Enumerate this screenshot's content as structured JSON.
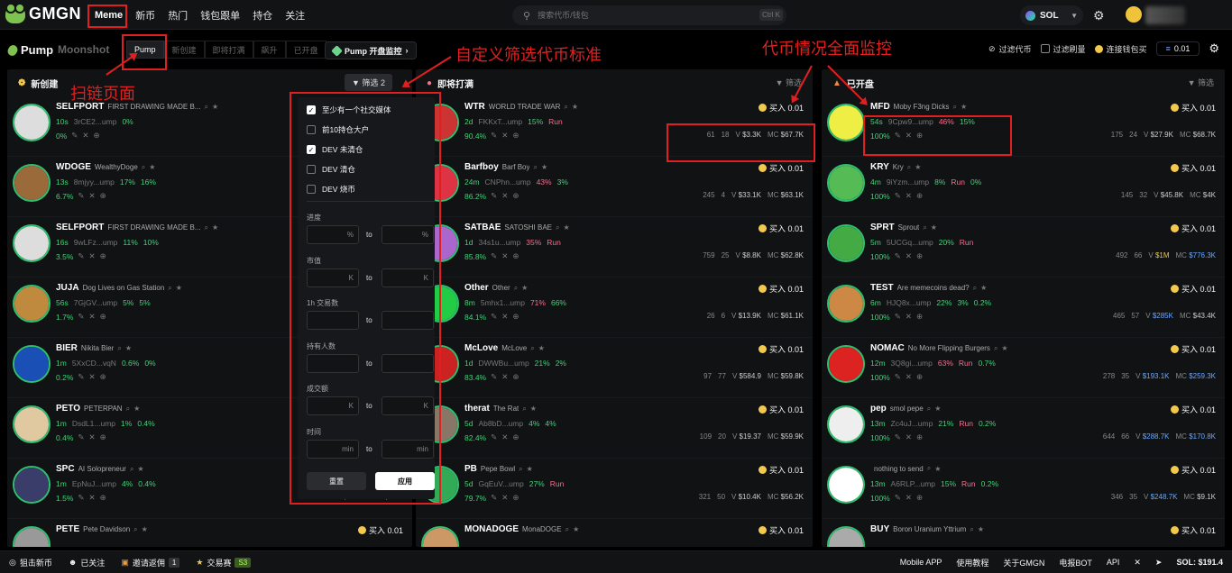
{
  "header": {
    "logo": "GMGN",
    "nav": [
      "Meme",
      "新币",
      "热门",
      "钱包跟单",
      "持仓",
      "关注"
    ],
    "search_placeholder": "搜索代币/钱包",
    "search_kbd": "Ctrl K",
    "chain": "SOL"
  },
  "subbar": {
    "pump": "Pump",
    "moonshot": "Moonshot",
    "tabs": [
      "Pump",
      "新创建",
      "即将打满",
      "飙升",
      "已开盘"
    ],
    "monitor": "Pump 开盘监控",
    "filter_coins": "过滤代币",
    "filter_dup": "过滤刷量",
    "link_wallet": "连接钱包买",
    "buy_amount": "0.01"
  },
  "columns": {
    "new": {
      "title": "新创建",
      "filter": "筛选",
      "filter_count": "2"
    },
    "soon": {
      "title": "即将打满",
      "filter": "筛选"
    },
    "opened": {
      "title": "已开盘",
      "filter": "筛选"
    }
  },
  "buy_label": "买入 0.01",
  "new_rows": [
    {
      "sym": "SELFPORT",
      "full": "FIRST DRAWING MADE B...",
      "age": "10s",
      "addr": "3rCE2...ump",
      "h1": "",
      "h2": "0%",
      "pct": "0%",
      "av": "#ddd"
    },
    {
      "sym": "WDOGE",
      "full": "WealthyDoge",
      "age": "13s",
      "addr": "8mjyy...ump",
      "h1": "17%",
      "h2": "16%",
      "pct": "6.7%",
      "av": "#9a6a3a"
    },
    {
      "sym": "SELFPORT",
      "full": "FIRST DRAWING MADE B...",
      "age": "16s",
      "addr": "9wLFz...ump",
      "h1": "11%",
      "h2": "10%",
      "pct": "3.5%",
      "av": "#ddd"
    },
    {
      "sym": "JUJA",
      "full": "Dog Lives on Gas Station",
      "age": "56s",
      "addr": "7GjGV...ump",
      "h1": "5%",
      "h2": "5%",
      "pct": "1.7%",
      "av": "#c08a3e"
    },
    {
      "sym": "BIER",
      "full": "Nikita Bier",
      "age": "1m",
      "addr": "5XxCD...vqN",
      "h1": "0.6%",
      "h2": "0%",
      "pct": "0.2%",
      "av": "#1a4fb5"
    },
    {
      "sym": "PETO",
      "full": "PETERPAN",
      "age": "1m",
      "addr": "DsdL1...ump",
      "h1": "1%",
      "h2": "0.4%",
      "pct": "0.4%",
      "av": "#e0c8a0"
    },
    {
      "sym": "SPC",
      "full": "AI Solopreneur",
      "age": "1m",
      "addr": "EpNuJ...ump",
      "h1": "4%",
      "h2": "0.4%",
      "pct": "1.5%",
      "av": "#3a3d6a",
      "st1": "3",
      "st2": "$264.7",
      "mc": "$5.8K"
    },
    {
      "sym": "PETE",
      "full": "Pete Davidson",
      "age": "",
      "addr": "",
      "h1": "",
      "h2": "",
      "pct": "",
      "av": "#999"
    }
  ],
  "soon_rows": [
    {
      "sym": "WTR",
      "full": "WORLD TRADE WAR",
      "age": "2d",
      "addr": "FKKxT...ump",
      "h1": "15%",
      "h1c": "g",
      "h2": "Run",
      "h2c": "r",
      "pct": "90.4%",
      "s1": "61",
      "s2": "18",
      "v": "$3.3K",
      "mc": "$67.7K",
      "av": "#c33"
    },
    {
      "sym": "Barfboy",
      "full": "Barf Boy",
      "age": "24m",
      "addr": "CNPhn...ump",
      "h1": "43%",
      "h1c": "r",
      "h2": "3%",
      "h2c": "g",
      "pct": "86.2%",
      "s1": "245",
      "s2": "4",
      "v": "$33.1K",
      "mc": "$63.1K",
      "av": "#d34"
    },
    {
      "sym": "SATBAE",
      "full": "SATOSHI BAE",
      "age": "1d",
      "addr": "34s1u...ump",
      "h1": "35%",
      "h1c": "r",
      "h2": "Run",
      "h2c": "r",
      "pct": "85.8%",
      "s1": "759",
      "s2": "25",
      "v": "$8.8K",
      "mc": "$62.8K",
      "av": "#a6c"
    },
    {
      "sym": "Other",
      "full": "Other",
      "age": "8m",
      "addr": "5mhx1...ump",
      "h1": "71%",
      "h1c": "r",
      "h2": "66%",
      "h2c": "g",
      "pct": "84.1%",
      "s1": "26",
      "s2": "6",
      "v": "$13.9K",
      "mc": "$61.1K",
      "av": "#2c4"
    },
    {
      "sym": "McLove",
      "full": "McLove",
      "age": "1d",
      "addr": "DWWBu...ump",
      "h1": "21%",
      "h1c": "g",
      "h2": "2%",
      "h2c": "g",
      "pct": "83.4%",
      "s1": "97",
      "s2": "77",
      "v": "$584.9",
      "mc": "$59.8K",
      "av": "#c22"
    },
    {
      "sym": "therat",
      "full": "The Rat",
      "age": "5d",
      "addr": "Ab8bD...ump",
      "h1": "4%",
      "h1c": "g",
      "h2": "4%",
      "h2c": "g",
      "pct": "82.4%",
      "s1": "109",
      "s2": "20",
      "v": "$19.37",
      "mc": "$59.9K",
      "av": "#876"
    },
    {
      "sym": "PB",
      "full": "Pepe Bowl",
      "age": "5d",
      "addr": "GqEuV...ump",
      "h1": "27%",
      "h1c": "g",
      "h2": "Run",
      "h2c": "r",
      "pct": "79.7%",
      "s1": "321",
      "s2": "50",
      "v": "$10.4K",
      "mc": "$56.2K",
      "av": "#3a5"
    },
    {
      "sym": "MONADOGE",
      "full": "MonaDOGE",
      "age": "",
      "addr": "",
      "h1": "",
      "h1c": "g",
      "h2": "",
      "h2c": "g",
      "pct": "",
      "s1": "",
      "s2": "",
      "v": "",
      "mc": "",
      "av": "#c96"
    }
  ],
  "opened_rows": [
    {
      "sym": "MFD",
      "full": "Moby F3ng Dicks",
      "age": "54s",
      "addr": "9Cpw9...ump",
      "h1": "46%",
      "h1c": "r",
      "h2": "15%",
      "h2c": "g",
      "h3": "",
      "pct": "100%",
      "s1": "175",
      "s2": "24",
      "v": "$27.9K",
      "mc": "$68.7K",
      "vc": "",
      "mcc": "",
      "av": "#ee4"
    },
    {
      "sym": "KRY",
      "full": "Kry",
      "age": "4m",
      "addr": "9iYzm...ump",
      "h1": "8%",
      "h1c": "g",
      "h2": "Run",
      "h2c": "r",
      "h3": "0%",
      "pct": "100%",
      "s1": "145",
      "s2": "32",
      "v": "$45.8K",
      "mc": "$4K",
      "vc": "",
      "mcc": "",
      "av": "#5b5"
    },
    {
      "sym": "SPRT",
      "full": "Sprout",
      "age": "5m",
      "addr": "5UCGq...ump",
      "h1": "20%",
      "h1c": "g",
      "h2": "Run",
      "h2c": "r",
      "h3": "",
      "pct": "100%",
      "s1": "492",
      "s2": "66",
      "v": "$1M",
      "mc": "$776.3K",
      "vc": "yel",
      "mcc": "blue",
      "av": "#4a4"
    },
    {
      "sym": "TEST",
      "full": "Are memecoins dead?",
      "age": "6m",
      "addr": "HJQ8x...ump",
      "h1": "22%",
      "h1c": "g",
      "h2": "3%",
      "h2c": "g",
      "h3": "0.2%",
      "pct": "100%",
      "s1": "465",
      "s2": "57",
      "v": "$285K",
      "mc": "$43.4K",
      "vc": "blue",
      "mcc": "",
      "av": "#c84"
    },
    {
      "sym": "NOMAC",
      "full": "No More Flipping Burgers",
      "age": "12m",
      "addr": "3Q8gi...ump",
      "h1": "63%",
      "h1c": "r",
      "h2": "Run",
      "h2c": "r",
      "h3": "0.7%",
      "pct": "100%",
      "s1": "278",
      "s2": "35",
      "v": "$193.1K",
      "mc": "$259.3K",
      "vc": "blue",
      "mcc": "blue",
      "av": "#d22"
    },
    {
      "sym": "pep",
      "full": "smol pepe",
      "age": "13m",
      "addr": "Zc4uJ...ump",
      "h1": "21%",
      "h1c": "g",
      "h2": "Run",
      "h2c": "r",
      "h3": "0.2%",
      "pct": "100%",
      "s1": "644",
      "s2": "66",
      "v": "$288.7K",
      "mc": "$170.8K",
      "vc": "blue",
      "mcc": "blue",
      "av": "#eee"
    },
    {
      "sym": "",
      "full": "nothing to send",
      "age": "13m",
      "addr": "A6RLP...ump",
      "h1": "15%",
      "h1c": "g",
      "h2": "Run",
      "h2c": "r",
      "h3": "0.2%",
      "pct": "100%",
      "s1": "346",
      "s2": "35",
      "v": "$248.7K",
      "mc": "$9.1K",
      "vc": "blue",
      "mcc": "",
      "av": "#fff"
    },
    {
      "sym": "BUY",
      "full": "Boron Uranium Yttrium",
      "age": "",
      "addr": "",
      "h1": "",
      "h1c": "g",
      "h2": "",
      "h2c": "g",
      "h3": "",
      "pct": "",
      "s1": "",
      "s2": "",
      "v": "",
      "mc": "",
      "vc": "",
      "mcc": "",
      "av": "#aaa"
    }
  ],
  "filter_panel": {
    "checks": [
      {
        "label": "至少有一个社交媒体",
        "on": true
      },
      {
        "label": "前10持仓大户",
        "on": false
      },
      {
        "label": "DEV 未清仓",
        "on": true
      },
      {
        "label": "DEV 清仓",
        "on": false
      },
      {
        "label": "DEV 烧币",
        "on": false
      }
    ],
    "fields": [
      {
        "label": "进度",
        "unit": "%"
      },
      {
        "label": "市值",
        "unit": "K"
      },
      {
        "label": "1h 交易数",
        "unit": ""
      },
      {
        "label": "持有人数",
        "unit": ""
      },
      {
        "label": "成交额",
        "unit": "K"
      },
      {
        "label": "时间",
        "unit": "min"
      }
    ],
    "to": "to",
    "reset": "重置",
    "apply": "应用"
  },
  "annotations": {
    "scan": "扫链页面",
    "custom": "自定义筛选代币标准",
    "monitor": "代币情况全面监控"
  },
  "bottom": {
    "items": [
      "狙击新币",
      "已关注",
      "邀请返佣",
      "交易赛"
    ],
    "invite_badge": "1",
    "race_badge": "S3",
    "right": [
      "Mobile APP",
      "使用教程",
      "关于GMGN",
      "电报BOT",
      "API"
    ],
    "sol": "SOL: $191.4"
  }
}
